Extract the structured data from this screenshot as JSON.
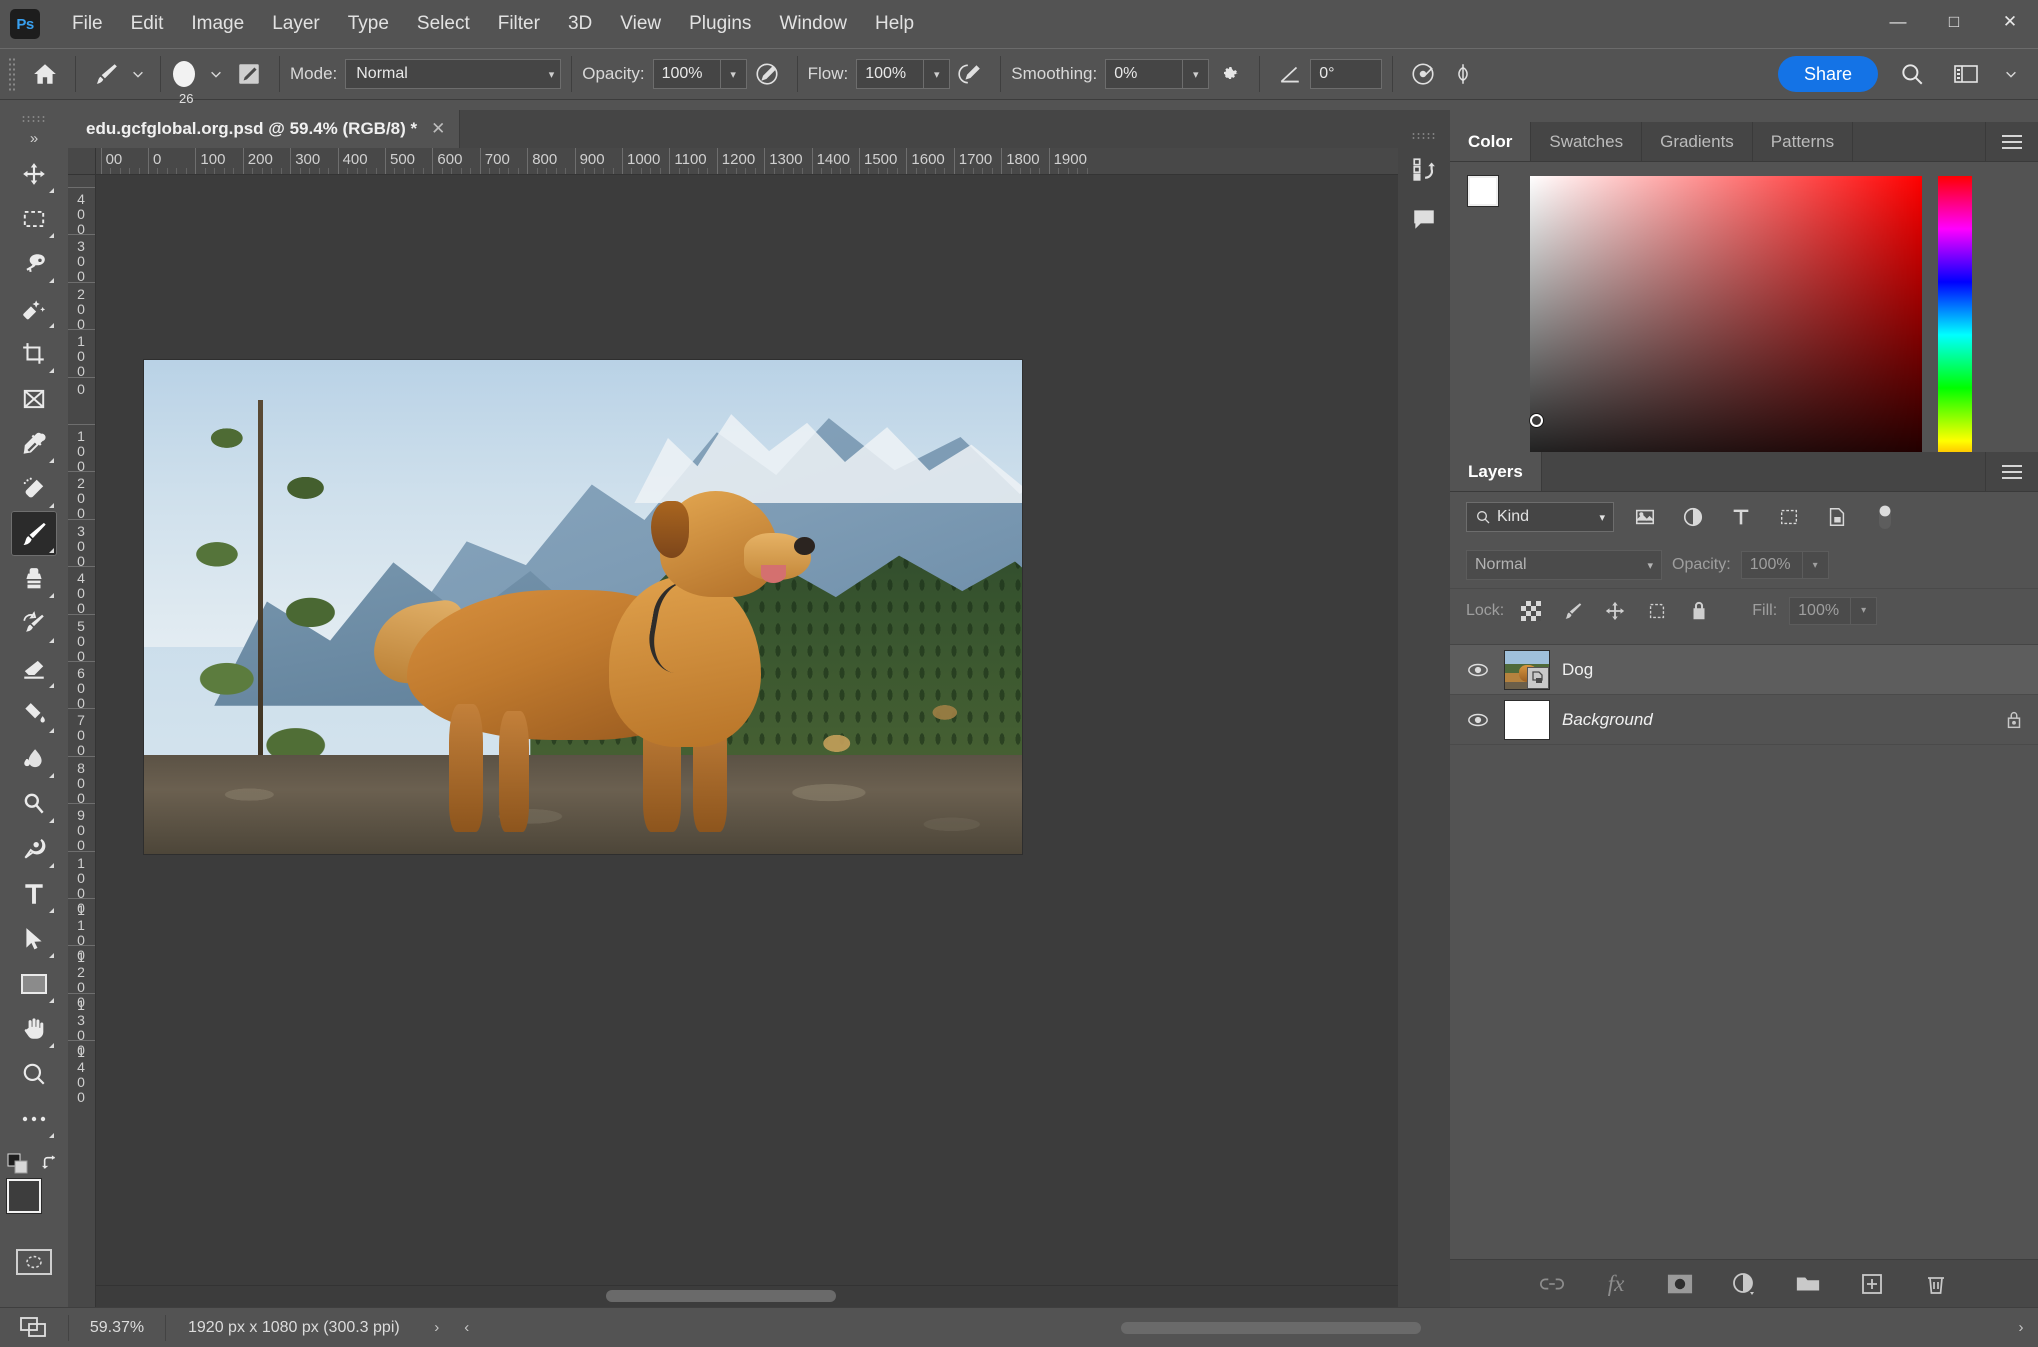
{
  "app": {
    "name": "Adobe Photoshop",
    "logo_text": "Ps",
    "accent_blue": "#1473e6",
    "bg": "#535353"
  },
  "menubar": {
    "items": [
      {
        "label": "File"
      },
      {
        "label": "Edit"
      },
      {
        "label": "Image"
      },
      {
        "label": "Layer"
      },
      {
        "label": "Type"
      },
      {
        "label": "Select"
      },
      {
        "label": "Filter"
      },
      {
        "label": "3D"
      },
      {
        "label": "View"
      },
      {
        "label": "Plugins"
      },
      {
        "label": "Window"
      },
      {
        "label": "Help"
      }
    ],
    "window_controls": {
      "minimize": "—",
      "maximize": "□",
      "close": "✕"
    }
  },
  "options_bar": {
    "home_icon": "home-icon",
    "brush_tool_icon": "brush-icon",
    "brush_size": "26",
    "brush_settings_icon": "brush-settings-icon",
    "mode_label": "Mode:",
    "mode_value": "Normal",
    "opacity_label": "Opacity:",
    "opacity_value": "100%",
    "pressure_opacity_icon": "pressure-opacity-icon",
    "flow_label": "Flow:",
    "flow_value": "100%",
    "airbrush_icon": "airbrush-icon",
    "smoothing_label": "Smoothing:",
    "smoothing_value": "0%",
    "smoothing_gear_icon": "gear-icon",
    "angle_icon": "angle-icon",
    "angle_value": "0°",
    "pressure_size_icon": "pressure-size-icon",
    "symmetry_icon": "symmetry-icon",
    "share_label": "Share",
    "search_icon": "search-icon",
    "workspace_icon": "workspace-icon",
    "workspace_chevron": "⌄"
  },
  "toolbar": {
    "tools": [
      {
        "name": "move-tool",
        "icon": "move-icon"
      },
      {
        "name": "rectangular-marquee-tool",
        "icon": "marquee-icon"
      },
      {
        "name": "object-selection-tool",
        "icon": "lasso-icon"
      },
      {
        "name": "quick-selection-tool",
        "icon": "magic-wand-icon"
      },
      {
        "name": "crop-tool",
        "icon": "crop-icon"
      },
      {
        "name": "frame-tool",
        "icon": "frame-icon"
      },
      {
        "name": "eyedropper-tool",
        "icon": "eyedropper-icon"
      },
      {
        "name": "spot-healing-brush-tool",
        "icon": "healing-brush-icon"
      },
      {
        "name": "brush-tool",
        "icon": "brush-icon",
        "active": true
      },
      {
        "name": "clone-stamp-tool",
        "icon": "stamp-icon"
      },
      {
        "name": "history-brush-tool",
        "icon": "history-brush-icon"
      },
      {
        "name": "eraser-tool",
        "icon": "eraser-icon"
      },
      {
        "name": "gradient-tool",
        "icon": "paint-bucket-icon"
      },
      {
        "name": "blur-tool",
        "icon": "blur-icon"
      },
      {
        "name": "dodge-tool",
        "icon": "dodge-icon"
      },
      {
        "name": "pen-tool",
        "icon": "pen-icon"
      },
      {
        "name": "type-tool",
        "icon": "type-icon"
      },
      {
        "name": "path-selection-tool",
        "icon": "path-select-icon"
      },
      {
        "name": "rectangle-tool",
        "icon": "rectangle-icon"
      },
      {
        "name": "hand-tool",
        "icon": "hand-icon"
      },
      {
        "name": "zoom-tool",
        "icon": "zoom-icon"
      },
      {
        "name": "edit-toolbar",
        "icon": "ellipsis-icon"
      }
    ],
    "default_colors_icon": "default-colors-icon",
    "swap_colors_icon": "swap-colors-icon",
    "foreground_color": "#3d3d3d",
    "background_color": "#ffffff",
    "quick_mask_icon": "quick-mask-icon"
  },
  "document": {
    "tab_title": "edu.gcfglobal.org.psd @ 59.4% (RGB/8) *",
    "close_icon": "✕",
    "canvas": {
      "image_alt": "golden-retriever-on-mountain-ridge",
      "ruler_h_ticks": [
        "0",
        "100",
        "200",
        "300",
        "400",
        "500",
        "600",
        "700",
        "800",
        "900",
        "1000",
        "1100",
        "1200",
        "1300",
        "1400",
        "1500",
        "1600",
        "1700",
        "1800",
        "1900"
      ],
      "ruler_v_ticks": [
        "400",
        "300",
        "200",
        "100",
        "0",
        "100",
        "200",
        "300",
        "400",
        "500",
        "600",
        "700",
        "800",
        "900",
        "1000",
        "1100",
        "1200",
        "1300",
        "1400"
      ],
      "collapse_chevron": "⌃"
    }
  },
  "mini_dock": {
    "collapse_icon": "«",
    "buttons": [
      {
        "name": "history-panel-icon"
      },
      {
        "name": "comments-panel-icon"
      }
    ]
  },
  "color_panel": {
    "tabs": [
      {
        "label": "Color",
        "active": true
      },
      {
        "label": "Swatches",
        "active": false
      },
      {
        "label": "Gradients",
        "active": false
      },
      {
        "label": "Patterns",
        "active": false
      }
    ],
    "menu_icon": "panel-menu-icon",
    "foreground_color": "#ffffff",
    "background_color": "#ffffff",
    "picker_base_hue": "#ff0000"
  },
  "layers_panel": {
    "tabs": [
      {
        "label": "Layers",
        "active": true
      }
    ],
    "menu_icon": "panel-menu-icon",
    "filter": {
      "search_icon": "search-icon",
      "kind_label": "Kind",
      "chevron": "⌄",
      "icons": [
        "filter-pixel-icon",
        "filter-adjustment-icon",
        "filter-type-icon",
        "filter-shape-icon",
        "filter-smart-icon"
      ],
      "toggle_icon": "filter-toggle-icon"
    },
    "blend": {
      "mode_value": "Normal",
      "chevron": "⌄",
      "opacity_label": "Opacity:",
      "opacity_value": "100%"
    },
    "lock": {
      "label": "Lock:",
      "icons": [
        "lock-transparent-icon",
        "lock-image-icon",
        "lock-position-icon",
        "lock-artboard-icon",
        "lock-all-icon"
      ],
      "fill_label": "Fill:",
      "fill_value": "100%"
    },
    "layers": [
      {
        "name": "Dog",
        "visible": true,
        "selected": true,
        "locked": false,
        "italic": false,
        "smart_object": true
      },
      {
        "name": "Background",
        "visible": true,
        "selected": false,
        "locked": true,
        "italic": true,
        "smart_object": false
      }
    ],
    "footer_icons": [
      {
        "name": "link-layers-icon",
        "glyph": "link",
        "dim": true
      },
      {
        "name": "layer-style-icon",
        "glyph": "fx",
        "dim": true
      },
      {
        "name": "layer-mask-icon",
        "glyph": "mask",
        "dim": false
      },
      {
        "name": "adjustment-layer-icon",
        "glyph": "adjust",
        "dim": false
      },
      {
        "name": "new-group-icon",
        "glyph": "folder",
        "dim": false
      },
      {
        "name": "new-layer-icon",
        "glyph": "plus",
        "dim": false
      },
      {
        "name": "delete-layer-icon",
        "glyph": "trash",
        "dim": false
      }
    ]
  },
  "statusbar": {
    "screen_mode_icon": "screen-mode-icon",
    "zoom_value": "59.37%",
    "doc_info": "1920 px x 1080 px (300.3 ppi)",
    "expand_arrow": "›",
    "left_arrow": "‹",
    "right_arrow": "›"
  }
}
